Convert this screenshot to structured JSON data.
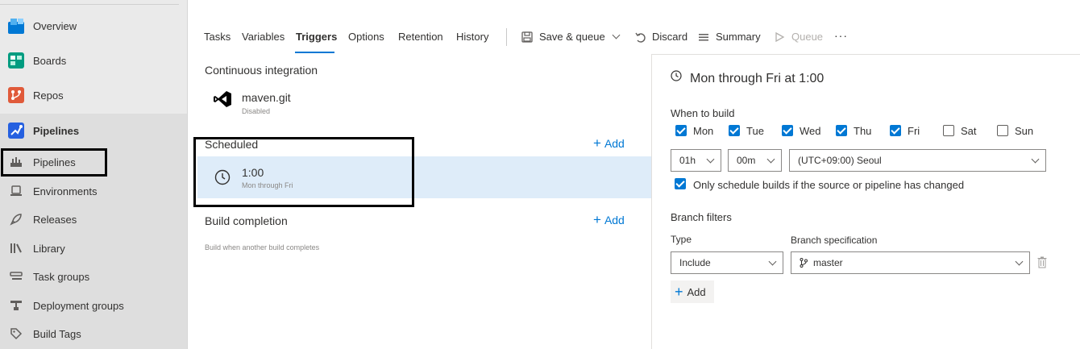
{
  "nav": {
    "items": [
      {
        "label": "Overview"
      },
      {
        "label": "Boards"
      },
      {
        "label": "Repos"
      },
      {
        "label": "Pipelines"
      }
    ],
    "subitems": [
      {
        "label": "Pipelines"
      },
      {
        "label": "Environments"
      },
      {
        "label": "Releases"
      },
      {
        "label": "Library"
      },
      {
        "label": "Task groups"
      },
      {
        "label": "Deployment groups"
      },
      {
        "label": "Build Tags"
      }
    ]
  },
  "tabs": [
    "Tasks",
    "Variables",
    "Triggers",
    "Options",
    "Retention",
    "History"
  ],
  "active_tab": "Triggers",
  "toolbar": {
    "save_queue": "Save & queue",
    "discard": "Discard",
    "summary": "Summary",
    "queue": "Queue",
    "more": "···"
  },
  "triggers": {
    "ci_title": "Continuous integration",
    "ci_repo": "maven.git",
    "ci_status": "Disabled",
    "scheduled_title": "Scheduled",
    "add_label": "Add",
    "schedule_time": "1:00",
    "schedule_desc": "Mon through Fri",
    "build_completion_title": "Build completion",
    "build_completion_desc": "Build when another build completes"
  },
  "schedule_detail": {
    "title": "Mon through Fri at 1:00",
    "when_to_build": "When to build",
    "days": [
      {
        "label": "Mon",
        "checked": true
      },
      {
        "label": "Tue",
        "checked": true
      },
      {
        "label": "Wed",
        "checked": true
      },
      {
        "label": "Thu",
        "checked": true
      },
      {
        "label": "Fri",
        "checked": true
      },
      {
        "label": "Sat",
        "checked": false
      },
      {
        "label": "Sun",
        "checked": false
      }
    ],
    "hour": "01h",
    "minute": "00m",
    "timezone": "(UTC+09:00) Seoul",
    "only_changed_label": "Only schedule builds if the source or pipeline has changed",
    "only_changed": true,
    "branch_filters": "Branch filters",
    "type_label": "Type",
    "type_value": "Include",
    "branch_spec_label": "Branch specification",
    "branch_spec_value": "master",
    "add_label": "Add"
  },
  "colors": {
    "accent": "#0078d4",
    "selected_row": "#deecf9"
  }
}
